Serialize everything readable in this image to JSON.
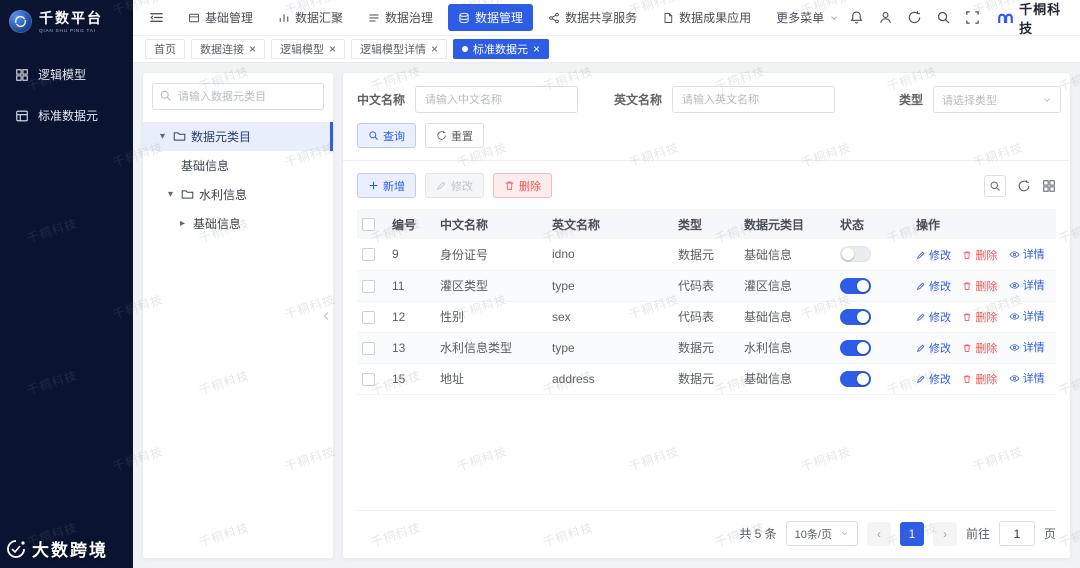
{
  "brand": {
    "logo_text": "千数平台",
    "logo_subtext": "QIAN SHU PING TAI",
    "watermark": "千桐科技",
    "corner_logo": "大数跨境"
  },
  "sidebar": {
    "items": [
      {
        "label": "逻辑模型"
      },
      {
        "label": "标准数据元"
      }
    ]
  },
  "topnav": {
    "items": [
      {
        "label": "基础管理",
        "active": false
      },
      {
        "label": "数据汇聚",
        "active": false
      },
      {
        "label": "数据治理",
        "active": false
      },
      {
        "label": "数据管理",
        "active": true
      },
      {
        "label": "数据共享服务",
        "active": false
      },
      {
        "label": "数据成果应用",
        "active": false
      },
      {
        "label": "更多菜单",
        "active": false
      }
    ],
    "company": "千桐科技"
  },
  "tabs": [
    {
      "label": "首页",
      "closable": false,
      "active": false
    },
    {
      "label": "数据连接",
      "closable": true,
      "active": false
    },
    {
      "label": "逻辑模型",
      "closable": true,
      "active": false
    },
    {
      "label": "逻辑模型详情",
      "closable": true,
      "active": false
    },
    {
      "label": "标准数据元",
      "closable": true,
      "active": true
    }
  ],
  "tree": {
    "search_placeholder": "请输入数据元类目",
    "nodes": [
      {
        "label": "数据元类目",
        "level": 0,
        "selected": true,
        "expanded": true
      },
      {
        "label": "基础信息",
        "level": 1
      },
      {
        "label": "水利信息",
        "level": 1,
        "expanded": true
      },
      {
        "label": "基础信息",
        "level": 2,
        "collapsed": true
      }
    ]
  },
  "filters": {
    "cn_label": "中文名称",
    "cn_placeholder": "请输入中文名称",
    "en_label": "英文名称",
    "en_placeholder": "请输入英文名称",
    "type_label": "类型",
    "type_placeholder": "请选择类型",
    "search_button": "查询",
    "reset_button": "重置"
  },
  "toolbar": {
    "add": "新增",
    "edit": "修改",
    "delete": "删除"
  },
  "table": {
    "headers": [
      "编号",
      "中文名称",
      "英文名称",
      "类型",
      "数据元类目",
      "状态",
      "操作"
    ],
    "rows": [
      {
        "id": "9",
        "cn": "身份证号",
        "en": "idno",
        "type": "数据元",
        "category": "基础信息",
        "status": false
      },
      {
        "id": "11",
        "cn": "灌区类型",
        "en": "type",
        "type": "代码表",
        "category": "灌区信息",
        "status": true
      },
      {
        "id": "12",
        "cn": "性别",
        "en": "sex",
        "type": "代码表",
        "category": "基础信息",
        "status": true
      },
      {
        "id": "13",
        "cn": "水利信息类型",
        "en": "type",
        "type": "数据元",
        "category": "水利信息",
        "status": true
      },
      {
        "id": "15",
        "cn": "地址",
        "en": "address",
        "type": "数据元",
        "category": "基础信息",
        "status": true
      }
    ],
    "actions": {
      "edit": "修改",
      "delete": "删除",
      "detail": "详情"
    }
  },
  "pagination": {
    "total": "共 5 条",
    "page_size": "10条/页",
    "prev": "‹",
    "next": "›",
    "current_page": "1",
    "goto_label": "前往",
    "goto_value": "1",
    "page_suffix": "页"
  },
  "colors": {
    "primary": "#2d5ce5",
    "danger": "#f25555",
    "sidebar_bg": "#0a1430"
  }
}
